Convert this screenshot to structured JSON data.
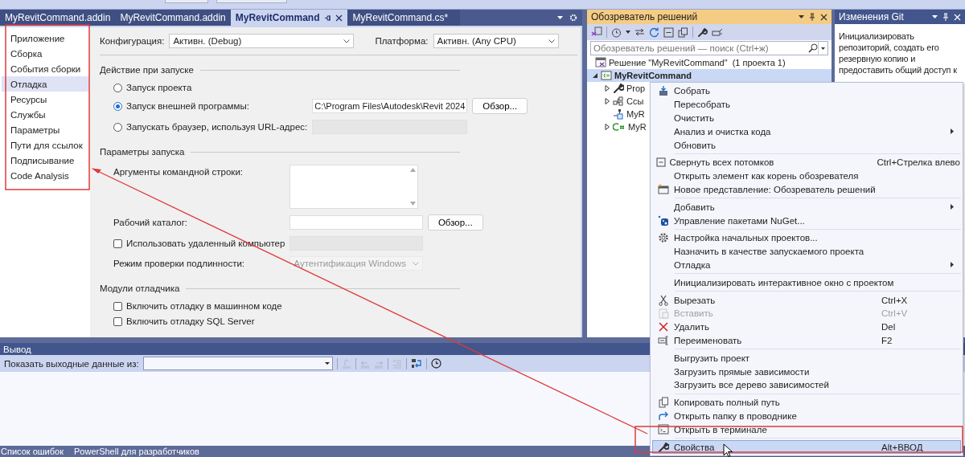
{
  "document_tabs": [
    {
      "label": "MyRevitCommand.addin",
      "selected": false
    },
    {
      "label": "MyRevitCommand.addin",
      "selected": false
    },
    {
      "label": "MyRevitCommand",
      "selected": true
    },
    {
      "label": "MyRevitCommand.cs*",
      "selected": false
    }
  ],
  "property_nav": [
    {
      "label": "Приложение",
      "selected": false
    },
    {
      "label": "Сборка",
      "selected": false
    },
    {
      "label": "События сборки",
      "selected": false
    },
    {
      "label": "Отладка",
      "selected": true
    },
    {
      "label": "Ресурсы",
      "selected": false
    },
    {
      "label": "Службы",
      "selected": false
    },
    {
      "label": "Параметры",
      "selected": false
    },
    {
      "label": "Пути для ссылок",
      "selected": false
    },
    {
      "label": "Подписывание",
      "selected": false
    },
    {
      "label": "Code Analysis",
      "selected": false
    }
  ],
  "configuration": {
    "label": "Конфигурация:",
    "value": "Активн. (Debug)"
  },
  "platform": {
    "label": "Платформа:",
    "value": "Активн. (Any CPU)"
  },
  "sections": [
    {
      "title": "Действие при запуске",
      "rows": [
        {
          "kind": "radio",
          "label": "Запуск проекта",
          "selected": false
        },
        {
          "kind": "radio",
          "label": "Запуск внешней программы:",
          "selected": true,
          "control": {
            "kind": "field",
            "value": "C:\\Program Files\\Autodesk\\Revit 2024",
            "disabled": false
          },
          "button": "Обзор..."
        },
        {
          "kind": "radio",
          "label": "Запускать браузер, используя URL-адрес:",
          "selected": false,
          "control": {
            "kind": "field",
            "disabled": true
          }
        }
      ]
    },
    {
      "title": "Параметры запуска",
      "rows": [
        {
          "kind": "label",
          "label": "Аргументы командной строки:",
          "control": {
            "kind": "textarea",
            "disabled": false
          }
        },
        {
          "kind": "label",
          "label": "Рабочий каталог:",
          "control": {
            "kind": "field",
            "disabled": false
          },
          "button": "Обзор..."
        },
        {
          "kind": "checkbox",
          "label": "Использовать удаленный компьютер",
          "checked": false,
          "control": {
            "kind": "field",
            "disabled": true
          }
        },
        {
          "kind": "label",
          "label": "Режим проверки подлинности:",
          "control": {
            "kind": "dropdown",
            "value": "Аутентификация Windows",
            "disabled": true
          }
        }
      ]
    },
    {
      "title": "Модули отладчика",
      "rows": [
        {
          "kind": "checkbox",
          "label": "Включить отладку в машинном коде",
          "checked": false
        },
        {
          "kind": "checkbox",
          "label": "Включить отладку SQL Server",
          "checked": false
        }
      ]
    }
  ],
  "solution_explorer": {
    "title": "Обозреватель решений",
    "search_placeholder": "Обозреватель решений — поиск (Ctrl+ж)",
    "tree": [
      {
        "label": "Решение \"MyRevitCommand\"  (1 проекта 1)",
        "kind": "solution",
        "selected": false,
        "startup": false,
        "children": [
          {
            "label": "MyRevitCommand",
            "kind": "project",
            "expanded": true,
            "selected": true,
            "startup": true,
            "children": [
              {
                "label": "Prop",
                "kind": "wrench",
                "expanded": false,
                "selected": false,
                "startup": false
              },
              {
                "label": "Ссы",
                "kind": "references",
                "expanded": false,
                "selected": false,
                "startup": false
              },
              {
                "label": "MyR",
                "kind": "addin",
                "selected": false,
                "startup": false
              },
              {
                "label": "MyR",
                "kind": "csharp",
                "expanded": false,
                "selected": false,
                "startup": false
              }
            ]
          }
        ]
      }
    ]
  },
  "git_changes": {
    "title": "Изменения Git",
    "text": "Инициализировать репозиторий, создать его резервную копию и предоставить общий доступ к"
  },
  "context_menu": {
    "groups": [
      [
        {
          "label": "Собрать",
          "kind": "build",
          "submenu": false,
          "disabled": false,
          "selected": false
        },
        {
          "label": "Пересобрать",
          "kind": "plain",
          "submenu": false,
          "disabled": false,
          "selected": false
        },
        {
          "label": "Очистить",
          "kind": "plain",
          "submenu": false,
          "disabled": false,
          "selected": false
        },
        {
          "label": "Анализ и очистка кода",
          "kind": "plain",
          "submenu": true,
          "disabled": false,
          "selected": false
        },
        {
          "label": "Обновить",
          "kind": "plain",
          "submenu": false,
          "disabled": false,
          "selected": false
        }
      ],
      [
        {
          "label": "Свернуть всех потомков",
          "kind": "collapse",
          "shortcut": "Ctrl+Стрелка влево",
          "submenu": false,
          "disabled": false,
          "selected": false
        },
        {
          "label": "Открыть элемент как корень обозревателя",
          "kind": "plain",
          "submenu": false,
          "disabled": false,
          "selected": false
        },
        {
          "label": "Новое представление: Обозреватель решений",
          "kind": "new-view",
          "submenu": false,
          "disabled": false,
          "selected": false
        }
      ],
      [
        {
          "label": "Добавить",
          "kind": "plain",
          "submenu": true,
          "disabled": false,
          "selected": false
        },
        {
          "label": "Управление пакетами NuGet...",
          "kind": "nuget",
          "submenu": false,
          "disabled": false,
          "selected": false
        }
      ],
      [
        {
          "label": "Настройка начальных проектов...",
          "kind": "settings",
          "submenu": false,
          "disabled": false,
          "selected": false
        },
        {
          "label": "Назначить в качестве запускаемого проекта",
          "kind": "plain",
          "submenu": false,
          "disabled": false,
          "selected": false
        },
        {
          "label": "Отладка",
          "kind": "plain",
          "submenu": true,
          "disabled": false,
          "selected": false
        }
      ],
      [
        {
          "label": "Инициализировать интерактивное окно с проектом",
          "kind": "plain",
          "submenu": false,
          "disabled": false,
          "selected": false
        }
      ],
      [
        {
          "label": "Вырезать",
          "kind": "cut",
          "shortcut": "Ctrl+X",
          "submenu": false,
          "disabled": false,
          "selected": false
        },
        {
          "label": "Вставить",
          "kind": "paste",
          "shortcut": "Ctrl+V",
          "submenu": false,
          "disabled": true,
          "selected": false
        },
        {
          "label": "Удалить",
          "kind": "delete",
          "shortcut": "Del",
          "submenu": false,
          "disabled": false,
          "selected": false
        },
        {
          "label": "Переименовать",
          "kind": "rename",
          "shortcut": "F2",
          "submenu": false,
          "disabled": false,
          "selected": false
        }
      ],
      [
        {
          "label": "Выгрузить проект",
          "kind": "plain",
          "submenu": false,
          "disabled": false,
          "selected": false
        },
        {
          "label": "Загрузить прямые зависимости",
          "kind": "plain",
          "submenu": false,
          "disabled": false,
          "selected": false
        },
        {
          "label": "Загрузить все дерево зависимостей",
          "kind": "plain",
          "submenu": false,
          "disabled": false,
          "selected": false
        }
      ],
      [
        {
          "label": "Копировать полный путь",
          "kind": "copy",
          "submenu": false,
          "disabled": false,
          "selected": false
        },
        {
          "label": "Открыть папку в проводнике",
          "kind": "redo",
          "submenu": false,
          "disabled": false,
          "selected": false
        },
        {
          "label": "Открыть в терминале",
          "kind": "terminal",
          "submenu": false,
          "disabled": false,
          "selected": false
        }
      ],
      [
        {
          "label": "Свойства",
          "kind": "wrench",
          "shortcut": "Alt+ВВОД",
          "submenu": false,
          "disabled": false,
          "selected": true
        }
      ]
    ]
  },
  "output": {
    "title": "Вывод",
    "source_label": "Показать выходные данные из:"
  },
  "bottom_tabs": [
    {
      "label": "Список ошибок"
    },
    {
      "label": "PowerShell для разработчиков"
    }
  ]
}
